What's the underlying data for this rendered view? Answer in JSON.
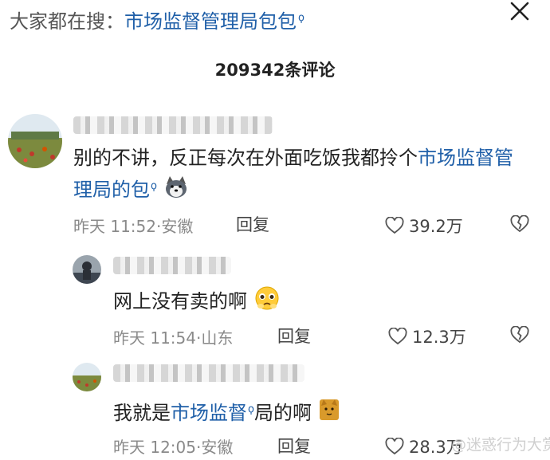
{
  "header": {
    "search_prefix": "大家都在搜：",
    "search_term": "市场监督管理局包包",
    "search_mark": "ϙ"
  },
  "comment_count": "209342条评论",
  "comments": [
    {
      "text_before": "别的不讲，反正每次在外面吃饭我都拎个",
      "link_text": "市场监督管理局的包",
      "link_mark": "ϙ",
      "time": "昨天 11:52",
      "location": "安徽",
      "reply_label": "回复",
      "likes": "39.2万"
    },
    {
      "text": "网上没有卖的啊",
      "time": "昨天 11:54",
      "location": "山东",
      "reply_label": "回复",
      "likes": "12.3万"
    },
    {
      "text_before": "我就是",
      "link_text": "市场监督",
      "link_mark": "ϙ",
      "text_after": "局的啊",
      "time": "昨天 12:05",
      "location": "安徽",
      "reply_label": "回复",
      "likes": "28.3万"
    }
  ],
  "meta_separator": "·",
  "watermark": "@迷惑行为大赏",
  "icons": {
    "close": "close-icon",
    "like": "heart-icon",
    "dislike": "broken-heart-icon",
    "emoji_1": "husky-dog-emoji",
    "emoji_2": "pleading-face-emoji",
    "emoji_3": "cat-emoji"
  },
  "colors": {
    "link": "#1f5fa8",
    "meta": "#8a8a8a"
  }
}
